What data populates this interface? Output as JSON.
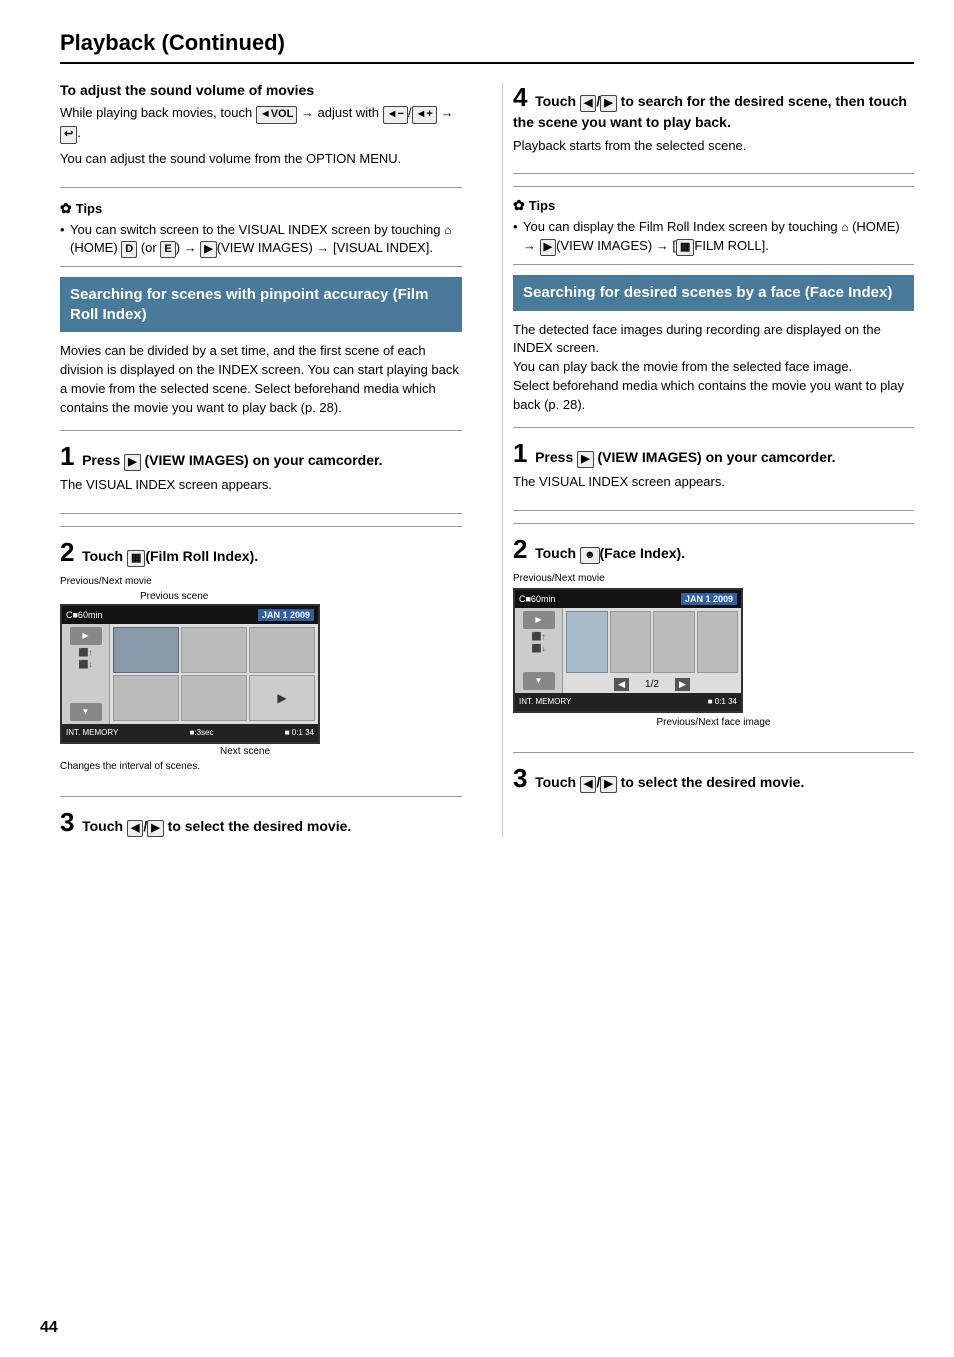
{
  "page": {
    "title": "Playback (Continued)",
    "page_number": "44"
  },
  "left": {
    "volume_section": {
      "heading": "To adjust the sound volume of movies",
      "body1": "While playing back movies, touch",
      "icon_vol": "VOL",
      "body2": "→ adjust with",
      "icon_minus": "◄−",
      "icon_plus": "◄+",
      "body3": "→",
      "icon_ret": "↩",
      "body4": "You can adjust the sound volume from the OPTION MENU."
    },
    "tips1": {
      "heading": "Tips",
      "items": [
        "You can switch screen to the VISUAL INDEX screen by touching  (HOME)  (or ) →  (VIEW IMAGES) → [VISUAL INDEX]."
      ]
    },
    "film_roll": {
      "box_heading": "Searching for scenes with pinpoint accuracy (Film Roll Index)",
      "body": "Movies can be divided by a set time, and the first scene of each division is displayed on the INDEX screen. You can start playing back a movie from the selected scene. Select beforehand media which contains the movie you want to play back (p. 28)."
    },
    "step1": {
      "number": "1",
      "text": "Press  (VIEW IMAGES) on your camcorder.",
      "desc": "The VISUAL INDEX screen appears."
    },
    "step2": {
      "number": "2",
      "text": "Touch (Film Roll Index).",
      "label_prev_next_movie": "Previous/Next movie",
      "label_prev_scene": "Previous scene",
      "label_next_scene": "Next scene",
      "label_changes": "Changes the interval of scenes."
    },
    "step3": {
      "number": "3",
      "text": "Touch / to select the desired movie."
    }
  },
  "right": {
    "step4": {
      "number": "4",
      "text": "Touch /  to search for the desired scene, then touch the scene you want to play back.",
      "desc": "Playback starts from the selected scene."
    },
    "tips2": {
      "heading": "Tips",
      "items": [
        "You can display the Film Roll Index screen by touching  (HOME) →  (VIEW IMAGES) → [ FILM ROLL]."
      ]
    },
    "face_index": {
      "box_heading": "Searching for desired scenes by a face (Face Index)",
      "body": "The detected face images during recording are displayed on the INDEX screen.\nYou can play back the movie from the selected face image.\nSelect beforehand media which contains the movie you want to play back (p. 28)."
    },
    "step1": {
      "number": "1",
      "text": "Press  (VIEW IMAGES) on your camcorder.",
      "desc": "The VISUAL INDEX screen appears."
    },
    "step2": {
      "number": "2",
      "text": "Touch (Face Index).",
      "label_prev_next_movie": "Previous/Next movie",
      "label_prev_next_face": "Previous/Next face image"
    },
    "step3": {
      "number": "3",
      "text": "Touch /  to select the desired movie."
    },
    "touch_label": "Touch"
  },
  "cam_screen": {
    "date": "JAN  1  2009",
    "memory": "INT. MEMORY",
    "time": "0:1",
    "count": "34",
    "battery": "C■60min",
    "interval": "■:3sec"
  },
  "cam_screen_face": {
    "date": "JAN  1  2009",
    "memory": "INT. MEMORY",
    "time": "0:1",
    "count": "34",
    "battery": "C■60min",
    "page_info": "1/2"
  }
}
